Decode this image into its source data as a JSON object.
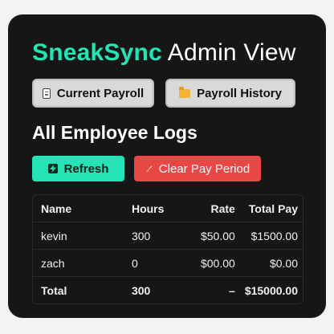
{
  "header": {
    "brand": "SneakSync",
    "title_rest": " Admin View"
  },
  "tabs": [
    {
      "label": "Current Payroll",
      "icon": "document-icon"
    },
    {
      "label": "Payroll History",
      "icon": "folder-icon"
    }
  ],
  "section": {
    "title": "All Employee Logs"
  },
  "actions": {
    "refresh_label": "Refresh",
    "clear_label": "Clear Pay Period"
  },
  "table": {
    "columns": [
      "Name",
      "Hours",
      "Rate",
      "Total Pay"
    ],
    "rows": [
      {
        "name": "kevin",
        "hours": "300",
        "rate": "$50.00",
        "total": "$1500.00"
      },
      {
        "name": "zach",
        "hours": "0",
        "rate": "$00.00",
        "total": "$0.00"
      }
    ],
    "total": {
      "label": "Total",
      "hours": "300",
      "rate": "–",
      "total": "$15000.00"
    }
  },
  "colors": {
    "accent": "#24e3b5",
    "danger": "#e94646",
    "panel": "#161616"
  }
}
